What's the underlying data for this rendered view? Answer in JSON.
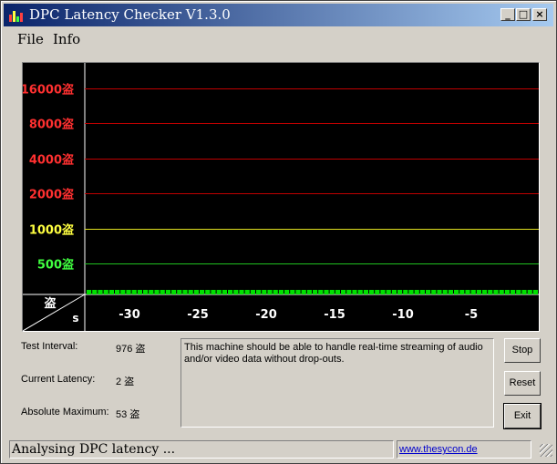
{
  "window": {
    "title": "DPC Latency Checker V1.3.0",
    "buttons": {
      "minimize": "_",
      "maximize": "□",
      "close": "×"
    }
  },
  "menu": {
    "items": [
      "File",
      "Info"
    ]
  },
  "chart_data": {
    "type": "bar",
    "y_scale": "log",
    "levels": [
      {
        "label": "16000盗",
        "value": 16000,
        "color": "#ff3030"
      },
      {
        "label": "8000盗",
        "value": 8000,
        "color": "#ff3030"
      },
      {
        "label": "4000盗",
        "value": 4000,
        "color": "#ff3030"
      },
      {
        "label": "2000盗",
        "value": 2000,
        "color": "#ff3030"
      },
      {
        "label": "1000盗",
        "value": 1000,
        "color": "#ffff40"
      },
      {
        "label": "500盗",
        "value": 500,
        "color": "#40ff40"
      }
    ],
    "corner_labels": {
      "y_unit": "盗",
      "x_unit": "s"
    },
    "x_ticks": [
      "-30",
      "-25",
      "-20",
      "-15",
      "-10",
      "-5"
    ],
    "bar_color": "#00e000",
    "bar_level": 2
  },
  "info": {
    "test_interval_label": "Test Interval:",
    "test_interval_value": "976 盗",
    "current_latency_label": "Current Latency:",
    "current_latency_value": "2 盗",
    "absolute_maximum_label": "Absolute Maximum:",
    "absolute_maximum_value": "53 盗"
  },
  "message": "This machine should be able to handle real-time streaming of audio and/or video data without drop-outs.",
  "buttons": {
    "stop": "Stop",
    "reset": "Reset",
    "exit": "Exit"
  },
  "status": {
    "text": "Analysing DPC latency ...",
    "link": "www.thesycon.de"
  },
  "icon_names": {
    "app": "bar-chart-icon"
  }
}
